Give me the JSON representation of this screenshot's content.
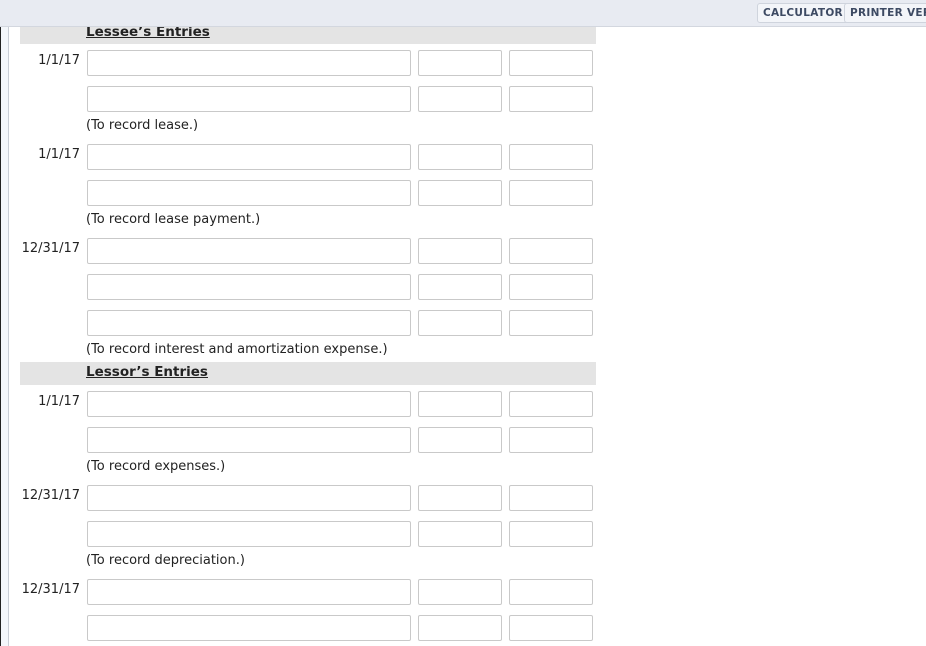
{
  "toolbar": {
    "calculator_label": "CALCULATOR",
    "printer_label": "PRINTER VERSION"
  },
  "sections": {
    "lessee": {
      "title": "Lessee’s Entries",
      "entries": [
        {
          "date": "1/1/17",
          "lines": [
            {
              "account": "",
              "debit": "",
              "credit": ""
            },
            {
              "account": "",
              "debit": "",
              "credit": ""
            }
          ],
          "note": "(To record lease.)"
        },
        {
          "date": "1/1/17",
          "lines": [
            {
              "account": "",
              "debit": "",
              "credit": ""
            },
            {
              "account": "",
              "debit": "",
              "credit": ""
            }
          ],
          "note": "(To record lease payment.)"
        },
        {
          "date": "12/31/17",
          "lines": [
            {
              "account": "",
              "debit": "",
              "credit": ""
            },
            {
              "account": "",
              "debit": "",
              "credit": ""
            },
            {
              "account": "",
              "debit": "",
              "credit": ""
            }
          ],
          "note": "(To record interest and amortization expense.)"
        }
      ]
    },
    "lessor": {
      "title": "Lessor’s Entries",
      "entries": [
        {
          "date": "1/1/17",
          "lines": [
            {
              "account": "",
              "debit": "",
              "credit": ""
            },
            {
              "account": "",
              "debit": "",
              "credit": ""
            }
          ],
          "note": "(To record expenses.)"
        },
        {
          "date": "12/31/17",
          "lines": [
            {
              "account": "",
              "debit": "",
              "credit": ""
            },
            {
              "account": "",
              "debit": "",
              "credit": ""
            }
          ],
          "note": "(To record depreciation.)"
        },
        {
          "date": "12/31/17",
          "lines": [
            {
              "account": "",
              "debit": "",
              "credit": ""
            },
            {
              "account": "",
              "debit": "",
              "credit": ""
            }
          ],
          "note": ""
        }
      ]
    }
  }
}
